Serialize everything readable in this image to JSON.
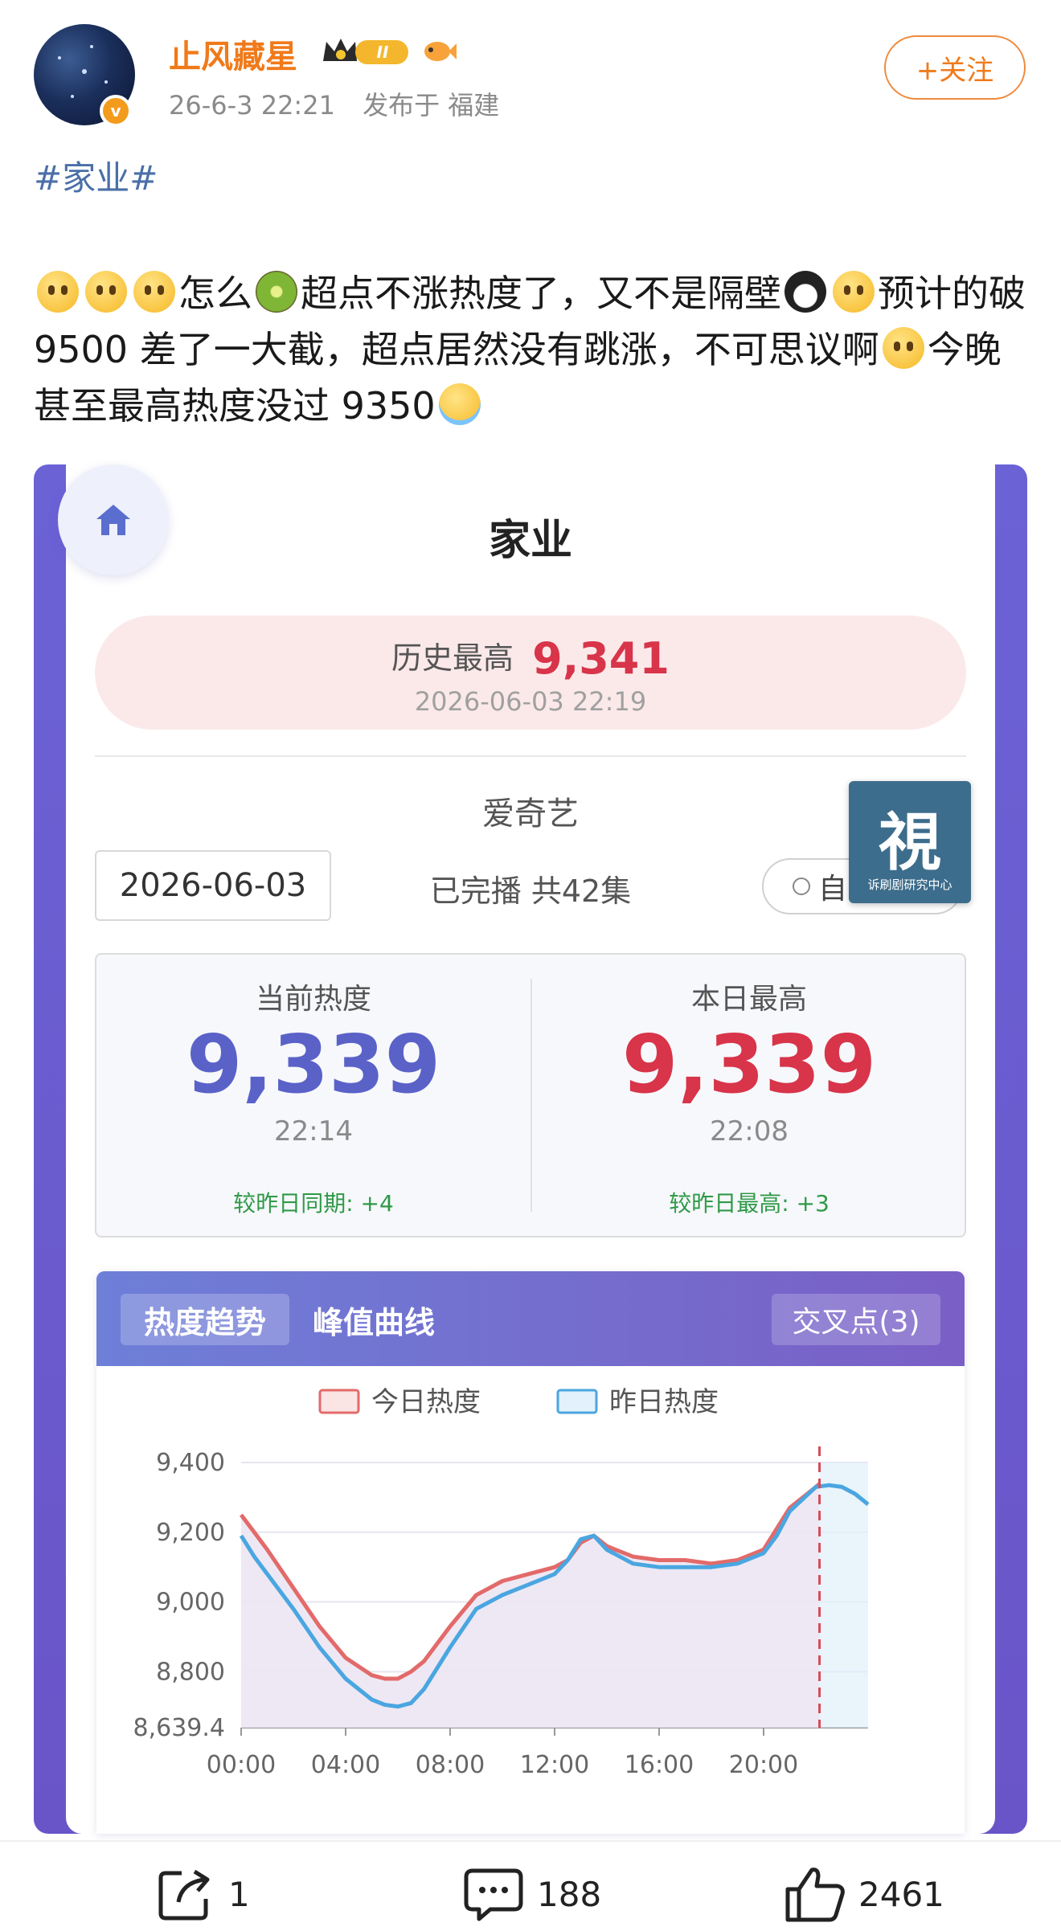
{
  "post": {
    "username": "止风藏星",
    "level_badge": "II",
    "timestamp": "26-6-3 22:21",
    "location": "发布于 福建",
    "follow_label": "+关注",
    "topic": "#家业#",
    "text_parts": {
      "p1": "怎么",
      "p2": "超点不涨热度了，又不是隔壁",
      "p3": "预计的破 9500 差了一大截，超点居然没有跳涨，不可思议啊",
      "p4": "今晚甚至最高热度没过 9350"
    }
  },
  "app": {
    "title": "家业",
    "record_label": "历史最高",
    "record_value": "9,341",
    "record_time": "2026-06-03 22:19",
    "platform": "爱奇艺",
    "date": "2026-06-03",
    "status": "已完播 共42集",
    "auto_label": "自",
    "watermark_big": "視",
    "watermark_small": "诉刷剧研究中心",
    "current": {
      "label": "当前热度",
      "value": "9,339",
      "time": "22:14",
      "delta": "较昨日同期: +4",
      "color": "#5a62c8"
    },
    "daily_high": {
      "label": "本日最高",
      "value": "9,339",
      "time": "22:08",
      "delta": "较昨日最高: +3",
      "color": "#d8344a"
    },
    "tabs": {
      "trend": "热度趋势",
      "peak": "峰值曲线",
      "cross": "交叉点(3)"
    }
  },
  "chart_data": {
    "type": "line",
    "legend": [
      "今日热度",
      "昨日热度"
    ],
    "y_ticks": [
      "9,400",
      "9,200",
      "9,000",
      "8,800",
      "8,639.4"
    ],
    "x_ticks": [
      "00:00",
      "04:00",
      "08:00",
      "12:00",
      "16:00",
      "20:00"
    ],
    "ylim": [
      8639.4,
      9400
    ],
    "xlim": [
      0,
      24
    ],
    "marker_x": 22.14,
    "series": [
      {
        "name": "今日热度",
        "color": "#e36a6a",
        "x": [
          0,
          0.5,
          1,
          2,
          3,
          4,
          5,
          5.5,
          6,
          6.5,
          7,
          8,
          9,
          10,
          11,
          12,
          12.5,
          13,
          13.5,
          14,
          15,
          16,
          17,
          18,
          19,
          20,
          20.5,
          21,
          22,
          22.14
        ],
        "y": [
          9250,
          9200,
          9150,
          9040,
          8930,
          8840,
          8790,
          8780,
          8780,
          8800,
          8830,
          8930,
          9020,
          9060,
          9080,
          9100,
          9120,
          9170,
          9190,
          9160,
          9130,
          9120,
          9120,
          9110,
          9120,
          9150,
          9210,
          9270,
          9330,
          9339
        ]
      },
      {
        "name": "昨日热度",
        "color": "#4aa6e0",
        "x": [
          0,
          0.5,
          1,
          2,
          3,
          4,
          5,
          5.5,
          6,
          6.5,
          7,
          8,
          9,
          10,
          11,
          12,
          12.5,
          13,
          13.5,
          14,
          15,
          16,
          17,
          18,
          19,
          20,
          20.5,
          21,
          22,
          22.5,
          23,
          23.5,
          24
        ],
        "y": [
          9190,
          9130,
          9080,
          8980,
          8870,
          8780,
          8720,
          8705,
          8700,
          8710,
          8750,
          8870,
          8980,
          9020,
          9050,
          9080,
          9120,
          9180,
          9190,
          9150,
          9110,
          9100,
          9100,
          9100,
          9110,
          9140,
          9190,
          9260,
          9330,
          9335,
          9330,
          9310,
          9280
        ]
      }
    ]
  },
  "actions": {
    "share_count": "1",
    "comment_count": "188",
    "like_count": "2461"
  },
  "colors": {
    "accent": "#f07a1a",
    "topic": "#4a6fa8",
    "today": "#e36a6a",
    "yesterday": "#4aa6e0"
  }
}
